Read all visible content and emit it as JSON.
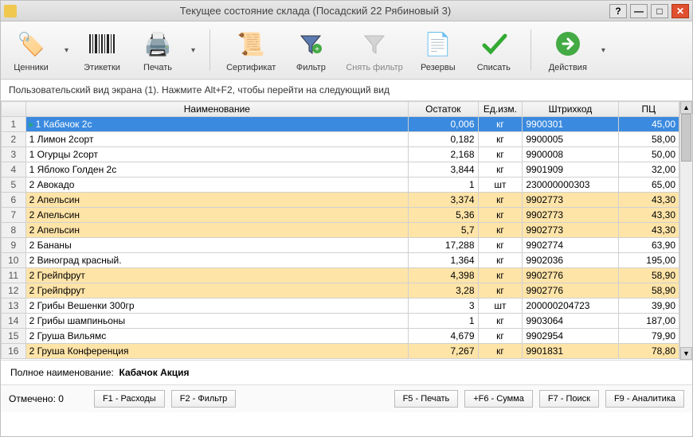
{
  "window": {
    "title": "Текущее состояние склада (Посадский   22 Рябиновый 3)"
  },
  "toolbar": {
    "price_tags": "Ценники",
    "labels": "Этикетки",
    "print": "Печать",
    "certificate": "Сертификат",
    "filter": "Фильтр",
    "clear_filter": "Снять фильтр",
    "reserves": "Резервы",
    "write_off": "Списать",
    "actions": "Действия"
  },
  "hint": "Пользовательский вид экрана (1). Нажмите Alt+F2, чтобы перейти на следующий вид",
  "columns": {
    "name": "Наименование",
    "balance": "Остаток",
    "unit": "Ед.изм.",
    "barcode": "Штрихкод",
    "pc": "ПЦ"
  },
  "rows": [
    {
      "n": 1,
      "name": "1 Кабачок 2с",
      "bal": "0,006",
      "unit": "кг",
      "bar": "9900301",
      "pc": "45,00",
      "sel": true
    },
    {
      "n": 2,
      "name": "1 Лимон 2сорт",
      "bal": "0,182",
      "unit": "кг",
      "bar": "9900005",
      "pc": "58,00"
    },
    {
      "n": 3,
      "name": "1 Огурцы 2сорт",
      "bal": "2,168",
      "unit": "кг",
      "bar": "9900008",
      "pc": "50,00"
    },
    {
      "n": 4,
      "name": "1 Яблоко Голден 2с",
      "bal": "3,844",
      "unit": "кг",
      "bar": "9901909",
      "pc": "32,00"
    },
    {
      "n": 5,
      "name": "2 Авокадо",
      "bal": "1",
      "unit": "шт",
      "bar": "230000000303",
      "pc": "65,00"
    },
    {
      "n": 6,
      "name": "2 Апельсин",
      "bal": "3,374",
      "unit": "кг",
      "bar": "9902773",
      "pc": "43,30",
      "hl": true
    },
    {
      "n": 7,
      "name": "2 Апельсин",
      "bal": "5,36",
      "unit": "кг",
      "bar": "9902773",
      "pc": "43,30",
      "hl": true
    },
    {
      "n": 8,
      "name": "2 Апельсин",
      "bal": "5,7",
      "unit": "кг",
      "bar": "9902773",
      "pc": "43,30",
      "hl": true
    },
    {
      "n": 9,
      "name": "2 Бананы",
      "bal": "17,288",
      "unit": "кг",
      "bar": "9902774",
      "pc": "63,90"
    },
    {
      "n": 10,
      "name": "2 Виноград красный.",
      "bal": "1,364",
      "unit": "кг",
      "bar": "9902036",
      "pc": "195,00"
    },
    {
      "n": 11,
      "name": "2 Грейпфрут",
      "bal": "4,398",
      "unit": "кг",
      "bar": "9902776",
      "pc": "58,90",
      "hl": true
    },
    {
      "n": 12,
      "name": "2 Грейпфрут",
      "bal": "3,28",
      "unit": "кг",
      "bar": "9902776",
      "pc": "58,90",
      "hl": true
    },
    {
      "n": 13,
      "name": "2 Грибы Вешенки 300гр",
      "bal": "3",
      "unit": "шт",
      "bar": "200000204723",
      "pc": "39,90"
    },
    {
      "n": 14,
      "name": "2 Грибы шампиньоны",
      "bal": "1",
      "unit": "кг",
      "bar": "9903064",
      "pc": "187,00"
    },
    {
      "n": 15,
      "name": "2 Груша Вильямс",
      "bal": "4,679",
      "unit": "кг",
      "bar": "9902954",
      "pc": "79,90"
    },
    {
      "n": 16,
      "name": "2 Груша Конференция",
      "bal": "7,267",
      "unit": "кг",
      "bar": "9901831",
      "pc": "78,80",
      "hl": true
    }
  ],
  "footer": {
    "full_name_label": "Полное наименование:",
    "full_name_value": "Кабачок Акция",
    "marked": "Отмечено: 0"
  },
  "fkeys": {
    "f1": "F1 - Расходы",
    "f2": "F2 - Фильтр",
    "f5": "F5 - Печать",
    "f6": "+F6 - Сумма",
    "f7": "F7 - Поиск",
    "f9": "F9 - Аналитика"
  }
}
